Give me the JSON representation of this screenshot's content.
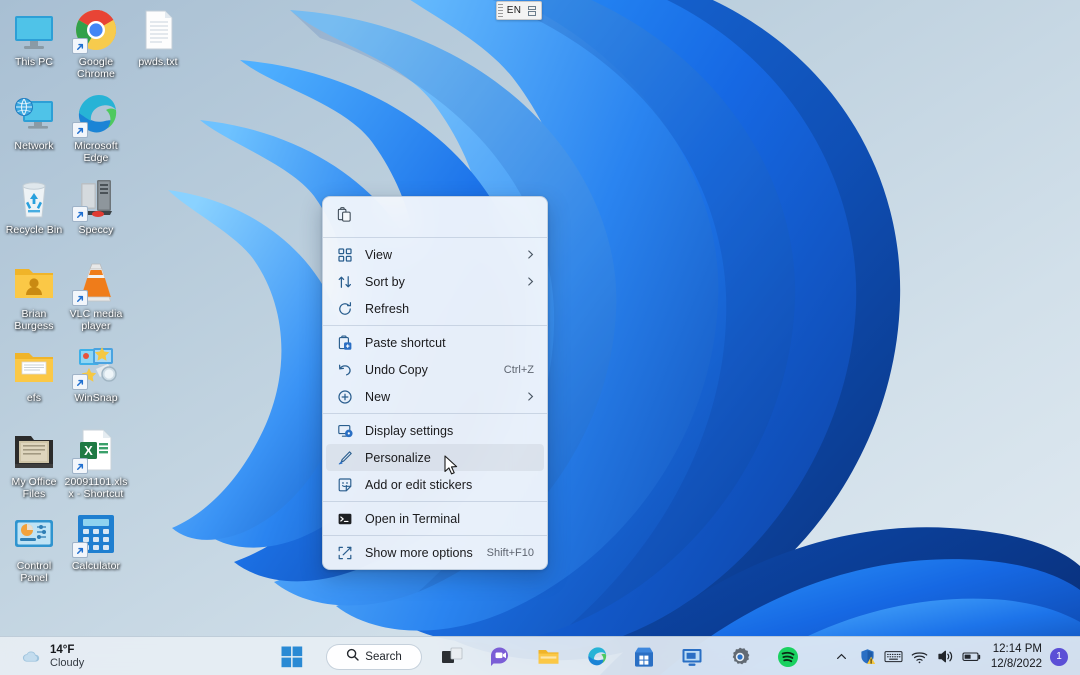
{
  "desktop": {
    "wallpaper_name": "windows-11-bloom-wallpaper",
    "background_color": "#c3d4e2",
    "accent_blue": "#1a6fe0",
    "icons": [
      {
        "label": "This PC",
        "icon": "this-pc-icon",
        "shortcut": false
      },
      {
        "label": "Google Chrome",
        "icon": "google-chrome-icon",
        "shortcut": true
      },
      {
        "label": "pwds.txt",
        "icon": "text-file-icon",
        "shortcut": false
      },
      {
        "label": "Network",
        "icon": "network-icon",
        "shortcut": false
      },
      {
        "label": "Microsoft Edge",
        "icon": "microsoft-edge-icon",
        "shortcut": true
      },
      {
        "label": "Recycle Bin",
        "icon": "recycle-bin-icon",
        "shortcut": false
      },
      {
        "label": "Speccy",
        "icon": "speccy-icon",
        "shortcut": true
      },
      {
        "label": "Brian Burgess",
        "icon": "user-folder-icon",
        "shortcut": false
      },
      {
        "label": "VLC media player",
        "icon": "vlc-media-player-icon",
        "shortcut": true
      },
      {
        "label": "efs",
        "icon": "folder-icon",
        "shortcut": false
      },
      {
        "label": "WinSnap",
        "icon": "winsnap-icon",
        "shortcut": true
      },
      {
        "label": "My Office Files",
        "icon": "office-files-folder-icon",
        "shortcut": false
      },
      {
        "label": "20091101.xlsx - Shortcut",
        "icon": "excel-file-icon",
        "shortcut": true
      },
      {
        "label": "Control Panel",
        "icon": "control-panel-icon",
        "shortcut": false
      },
      {
        "label": "Calculator",
        "icon": "calculator-icon",
        "shortcut": true
      }
    ]
  },
  "language_bar": {
    "code": "EN",
    "restore_icon": "restore-window-icon"
  },
  "context_menu": {
    "header_icons": [
      {
        "name": "clipboard-paste-icon"
      }
    ],
    "groups": [
      {
        "items": [
          {
            "label": "View",
            "icon": "view-grid-icon",
            "accel": "",
            "submenu": true,
            "selected": false
          },
          {
            "label": "Sort by",
            "icon": "sort-arrows-icon",
            "accel": "",
            "submenu": true,
            "selected": false
          },
          {
            "label": "Refresh",
            "icon": "refresh-icon",
            "accel": "",
            "submenu": false,
            "selected": false
          }
        ]
      },
      {
        "items": [
          {
            "label": "Paste shortcut",
            "icon": "paste-shortcut-icon",
            "accel": "",
            "submenu": false,
            "selected": false
          },
          {
            "label": "Undo Copy",
            "icon": "undo-icon",
            "accel": "Ctrl+Z",
            "submenu": false,
            "selected": false
          },
          {
            "label": "New",
            "icon": "new-plus-icon",
            "accel": "",
            "submenu": true,
            "selected": false
          }
        ]
      },
      {
        "items": [
          {
            "label": "Display settings",
            "icon": "display-settings-icon",
            "accel": "",
            "submenu": false,
            "selected": false
          },
          {
            "label": "Personalize",
            "icon": "personalize-brush-icon",
            "accel": "",
            "submenu": false,
            "selected": true
          },
          {
            "label": "Add or edit stickers",
            "icon": "stickers-icon",
            "accel": "",
            "submenu": false,
            "selected": false
          }
        ]
      },
      {
        "items": [
          {
            "label": "Open in Terminal",
            "icon": "terminal-icon",
            "accel": "",
            "submenu": false,
            "selected": false
          }
        ]
      },
      {
        "items": [
          {
            "label": "Show more options",
            "icon": "show-more-options-icon",
            "accel": "Shift+F10",
            "submenu": false,
            "selected": false
          }
        ]
      }
    ]
  },
  "cursor": {
    "name": "mouse-pointer-arrow"
  },
  "taskbar": {
    "weather": {
      "icon": "cloudy-weather-icon",
      "temperature": "14°F",
      "condition": "Cloudy"
    },
    "search": {
      "label": "Search",
      "icon": "search-icon"
    },
    "buttons": [
      {
        "name": "start-button",
        "icon": "windows-logo-icon",
        "active": false
      },
      {
        "name": "task-view-button",
        "icon": "task-view-icon",
        "active": false
      },
      {
        "name": "chat-button",
        "icon": "chat-teams-icon",
        "active": false
      },
      {
        "name": "file-explorer-button",
        "icon": "file-explorer-icon",
        "active": false
      },
      {
        "name": "edge-button",
        "icon": "microsoft-edge-icon",
        "active": false
      },
      {
        "name": "microsoft-store-button",
        "icon": "microsoft-store-icon",
        "active": false
      },
      {
        "name": "remote-desktop-button",
        "icon": "remote-desktop-icon",
        "active": false
      },
      {
        "name": "settings-button",
        "icon": "settings-gear-icon",
        "active": false
      },
      {
        "name": "spotify-button",
        "icon": "spotify-icon",
        "active": false
      }
    ],
    "tray": {
      "icons": [
        {
          "name": "show-hidden-icons-chevron",
          "icon": "chevron-up-icon"
        },
        {
          "name": "windows-security-icon",
          "icon": "shield-warning-icon"
        },
        {
          "name": "touch-keyboard-icon",
          "icon": "keyboard-icon"
        },
        {
          "name": "network-wifi-icon",
          "icon": "wifi-icon"
        },
        {
          "name": "volume-icon",
          "icon": "speaker-icon"
        },
        {
          "name": "battery-icon",
          "icon": "battery-icon"
        }
      ],
      "clock": {
        "time": "12:14 PM",
        "date": "12/8/2022"
      },
      "notification_count": "1"
    }
  }
}
